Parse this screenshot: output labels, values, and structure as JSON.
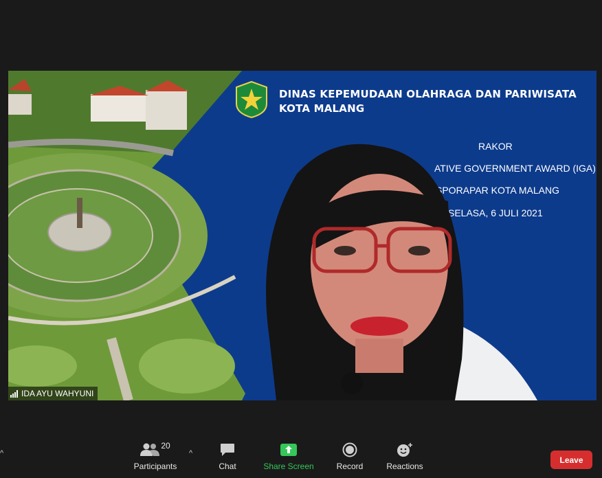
{
  "slide": {
    "org_line1": "DINAS KEPEMUDAAN OLAHRAGA DAN PARIWISATA",
    "org_line2": "KOTA MALANG",
    "line1": "RAKOR",
    "line2": "ATIVE GOVERNMENT AWARD (IGA)",
    "line3": "SPORAPAR KOTA MALANG",
    "line4": "SELASA, 6 JULI 2021"
  },
  "participant": {
    "name": "IDA AYU WAHYUNI"
  },
  "toolbar": {
    "participants_count": "20",
    "participants_label": "Participants",
    "chat_label": "Chat",
    "share_label": "Share Screen",
    "record_label": "Record",
    "reactions_label": "Reactions",
    "leave_label": "Leave"
  },
  "colors": {
    "background": "#1a1a1a",
    "slide_blue": "#0d3b8c",
    "share_green": "#35c759",
    "leave_red": "#d62e2e"
  }
}
